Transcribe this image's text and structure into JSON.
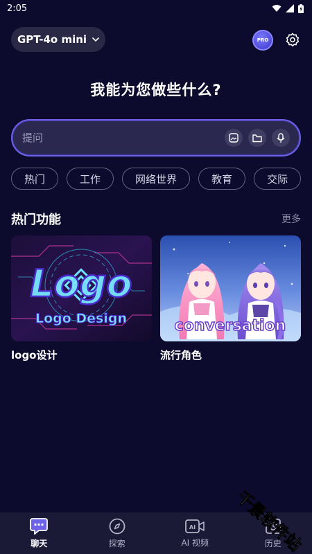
{
  "status_bar": {
    "time": "2:05"
  },
  "header": {
    "model_name": "GPT-4o mini",
    "pro_badge": "PRO"
  },
  "main": {
    "headline": "我能为您做些什么?",
    "input_placeholder": "提问",
    "categories": [
      "热门",
      "工作",
      "网络世界",
      "教育",
      "交际"
    ],
    "section_title": "热门功能",
    "more_label": "更多",
    "cards": [
      {
        "title": "logo设计",
        "image_text_1": "Logo",
        "image_text_2": "Logo Design"
      },
      {
        "title": "流行角色",
        "image_text": "conversation"
      }
    ]
  },
  "tab_bar": {
    "tabs": [
      {
        "label": "聊天",
        "icon": "chat-icon",
        "active": true
      },
      {
        "label": "探索",
        "icon": "compass-icon",
        "active": false
      },
      {
        "label": "AI 视频",
        "icon": "ai-video-icon",
        "active": false
      },
      {
        "label": "历史",
        "icon": "history-icon",
        "active": false
      }
    ]
  },
  "watermark": "千景软件站",
  "colors": {
    "background": "#0c0b2e",
    "accent": "#6d61e8",
    "tab_bar": "#1a1936"
  }
}
